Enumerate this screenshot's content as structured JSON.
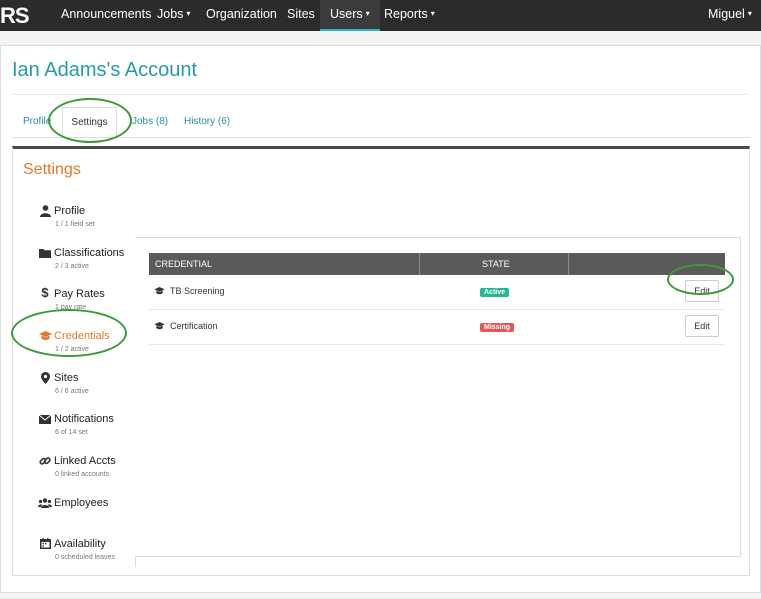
{
  "nav": {
    "logo": "RS",
    "items": [
      {
        "label": "Announcements",
        "caret": ""
      },
      {
        "label": "Jobs",
        "caret": "▾"
      },
      {
        "label": "Organization",
        "caret": ""
      },
      {
        "label": "Sites",
        "caret": ""
      },
      {
        "label": "Users",
        "caret": "▾"
      },
      {
        "label": "Reports",
        "caret": "▾"
      }
    ],
    "user": {
      "label": "Miguel",
      "caret": "▾"
    }
  },
  "page": {
    "title": "Ian Adams's Account"
  },
  "tabs": [
    {
      "label": "Profile"
    },
    {
      "label": "Settings"
    },
    {
      "label": "Jobs (8)"
    },
    {
      "label": "History (6)"
    }
  ],
  "settings": {
    "title": "Settings",
    "menu": [
      {
        "icon": "user-icon",
        "glyph": "👤",
        "label": "Profile",
        "sub": "1 / 1 field set"
      },
      {
        "icon": "folder-icon",
        "glyph": "▬",
        "label": "Classifications",
        "sub": "2 / 3 active"
      },
      {
        "icon": "dollar-icon",
        "glyph": "$",
        "label": "Pay Rates",
        "sub": "1 pay rate"
      },
      {
        "icon": "graduation-cap-icon",
        "glyph": "🎓",
        "label": "Credentials",
        "sub": "1 / 2 active"
      },
      {
        "icon": "map-marker-icon",
        "glyph": "📍",
        "label": "Sites",
        "sub": "6 / 6 active"
      },
      {
        "icon": "envelope-icon",
        "glyph": "✉",
        "label": "Notifications",
        "sub": "6 of 14 set"
      },
      {
        "icon": "link-icon",
        "glyph": "🔗",
        "label": "Linked Accts",
        "sub": "0 linked accounts"
      },
      {
        "icon": "users-icon",
        "glyph": "👥",
        "label": "Employees",
        "sub": ""
      },
      {
        "icon": "calendar-icon",
        "glyph": "▦",
        "label": "Availability",
        "sub": "0 scheduled leaves"
      }
    ]
  },
  "table": {
    "headers": {
      "credential": "CREDENTIAL",
      "state": "STATE"
    },
    "rows": [
      {
        "name": "TB Screening",
        "state": "Active",
        "action": "Edit"
      },
      {
        "name": "Certification",
        "state": "Missing",
        "action": "Edit"
      }
    ]
  },
  "colors": {
    "accent": "#2a9aa5",
    "orange": "#e07a2c",
    "active": "#2ab796",
    "missing": "#e05a5a",
    "highlight": "#3c9a3c"
  }
}
